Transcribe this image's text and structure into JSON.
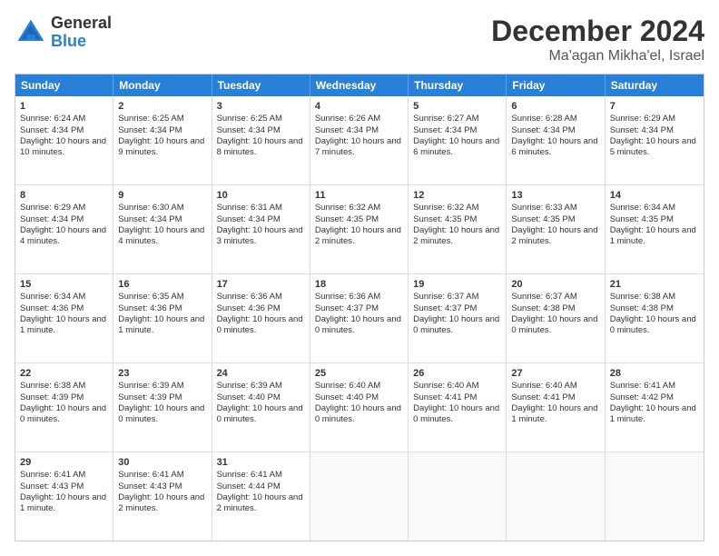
{
  "header": {
    "logo_general": "General",
    "logo_blue": "Blue",
    "month_title": "December 2024",
    "location": "Ma'agan Mikha'el, Israel"
  },
  "days_of_week": [
    "Sunday",
    "Monday",
    "Tuesday",
    "Wednesday",
    "Thursday",
    "Friday",
    "Saturday"
  ],
  "weeks": [
    [
      {
        "day": 1,
        "sunrise": "Sunrise: 6:24 AM",
        "sunset": "Sunset: 4:34 PM",
        "daylight": "Daylight: 10 hours and 10 minutes."
      },
      {
        "day": 2,
        "sunrise": "Sunrise: 6:25 AM",
        "sunset": "Sunset: 4:34 PM",
        "daylight": "Daylight: 10 hours and 9 minutes."
      },
      {
        "day": 3,
        "sunrise": "Sunrise: 6:25 AM",
        "sunset": "Sunset: 4:34 PM",
        "daylight": "Daylight: 10 hours and 8 minutes."
      },
      {
        "day": 4,
        "sunrise": "Sunrise: 6:26 AM",
        "sunset": "Sunset: 4:34 PM",
        "daylight": "Daylight: 10 hours and 7 minutes."
      },
      {
        "day": 5,
        "sunrise": "Sunrise: 6:27 AM",
        "sunset": "Sunset: 4:34 PM",
        "daylight": "Daylight: 10 hours and 6 minutes."
      },
      {
        "day": 6,
        "sunrise": "Sunrise: 6:28 AM",
        "sunset": "Sunset: 4:34 PM",
        "daylight": "Daylight: 10 hours and 6 minutes."
      },
      {
        "day": 7,
        "sunrise": "Sunrise: 6:29 AM",
        "sunset": "Sunset: 4:34 PM",
        "daylight": "Daylight: 10 hours and 5 minutes."
      }
    ],
    [
      {
        "day": 8,
        "sunrise": "Sunrise: 6:29 AM",
        "sunset": "Sunset: 4:34 PM",
        "daylight": "Daylight: 10 hours and 4 minutes."
      },
      {
        "day": 9,
        "sunrise": "Sunrise: 6:30 AM",
        "sunset": "Sunset: 4:34 PM",
        "daylight": "Daylight: 10 hours and 4 minutes."
      },
      {
        "day": 10,
        "sunrise": "Sunrise: 6:31 AM",
        "sunset": "Sunset: 4:34 PM",
        "daylight": "Daylight: 10 hours and 3 minutes."
      },
      {
        "day": 11,
        "sunrise": "Sunrise: 6:32 AM",
        "sunset": "Sunset: 4:35 PM",
        "daylight": "Daylight: 10 hours and 2 minutes."
      },
      {
        "day": 12,
        "sunrise": "Sunrise: 6:32 AM",
        "sunset": "Sunset: 4:35 PM",
        "daylight": "Daylight: 10 hours and 2 minutes."
      },
      {
        "day": 13,
        "sunrise": "Sunrise: 6:33 AM",
        "sunset": "Sunset: 4:35 PM",
        "daylight": "Daylight: 10 hours and 2 minutes."
      },
      {
        "day": 14,
        "sunrise": "Sunrise: 6:34 AM",
        "sunset": "Sunset: 4:35 PM",
        "daylight": "Daylight: 10 hours and 1 minute."
      }
    ],
    [
      {
        "day": 15,
        "sunrise": "Sunrise: 6:34 AM",
        "sunset": "Sunset: 4:36 PM",
        "daylight": "Daylight: 10 hours and 1 minute."
      },
      {
        "day": 16,
        "sunrise": "Sunrise: 6:35 AM",
        "sunset": "Sunset: 4:36 PM",
        "daylight": "Daylight: 10 hours and 1 minute."
      },
      {
        "day": 17,
        "sunrise": "Sunrise: 6:36 AM",
        "sunset": "Sunset: 4:36 PM",
        "daylight": "Daylight: 10 hours and 0 minutes."
      },
      {
        "day": 18,
        "sunrise": "Sunrise: 6:36 AM",
        "sunset": "Sunset: 4:37 PM",
        "daylight": "Daylight: 10 hours and 0 minutes."
      },
      {
        "day": 19,
        "sunrise": "Sunrise: 6:37 AM",
        "sunset": "Sunset: 4:37 PM",
        "daylight": "Daylight: 10 hours and 0 minutes."
      },
      {
        "day": 20,
        "sunrise": "Sunrise: 6:37 AM",
        "sunset": "Sunset: 4:38 PM",
        "daylight": "Daylight: 10 hours and 0 minutes."
      },
      {
        "day": 21,
        "sunrise": "Sunrise: 6:38 AM",
        "sunset": "Sunset: 4:38 PM",
        "daylight": "Daylight: 10 hours and 0 minutes."
      }
    ],
    [
      {
        "day": 22,
        "sunrise": "Sunrise: 6:38 AM",
        "sunset": "Sunset: 4:39 PM",
        "daylight": "Daylight: 10 hours and 0 minutes."
      },
      {
        "day": 23,
        "sunrise": "Sunrise: 6:39 AM",
        "sunset": "Sunset: 4:39 PM",
        "daylight": "Daylight: 10 hours and 0 minutes."
      },
      {
        "day": 24,
        "sunrise": "Sunrise: 6:39 AM",
        "sunset": "Sunset: 4:40 PM",
        "daylight": "Daylight: 10 hours and 0 minutes."
      },
      {
        "day": 25,
        "sunrise": "Sunrise: 6:40 AM",
        "sunset": "Sunset: 4:40 PM",
        "daylight": "Daylight: 10 hours and 0 minutes."
      },
      {
        "day": 26,
        "sunrise": "Sunrise: 6:40 AM",
        "sunset": "Sunset: 4:41 PM",
        "daylight": "Daylight: 10 hours and 0 minutes."
      },
      {
        "day": 27,
        "sunrise": "Sunrise: 6:40 AM",
        "sunset": "Sunset: 4:41 PM",
        "daylight": "Daylight: 10 hours and 1 minute."
      },
      {
        "day": 28,
        "sunrise": "Sunrise: 6:41 AM",
        "sunset": "Sunset: 4:42 PM",
        "daylight": "Daylight: 10 hours and 1 minute."
      }
    ],
    [
      {
        "day": 29,
        "sunrise": "Sunrise: 6:41 AM",
        "sunset": "Sunset: 4:43 PM",
        "daylight": "Daylight: 10 hours and 1 minute."
      },
      {
        "day": 30,
        "sunrise": "Sunrise: 6:41 AM",
        "sunset": "Sunset: 4:43 PM",
        "daylight": "Daylight: 10 hours and 2 minutes."
      },
      {
        "day": 31,
        "sunrise": "Sunrise: 6:41 AM",
        "sunset": "Sunset: 4:44 PM",
        "daylight": "Daylight: 10 hours and 2 minutes."
      },
      null,
      null,
      null,
      null
    ]
  ]
}
